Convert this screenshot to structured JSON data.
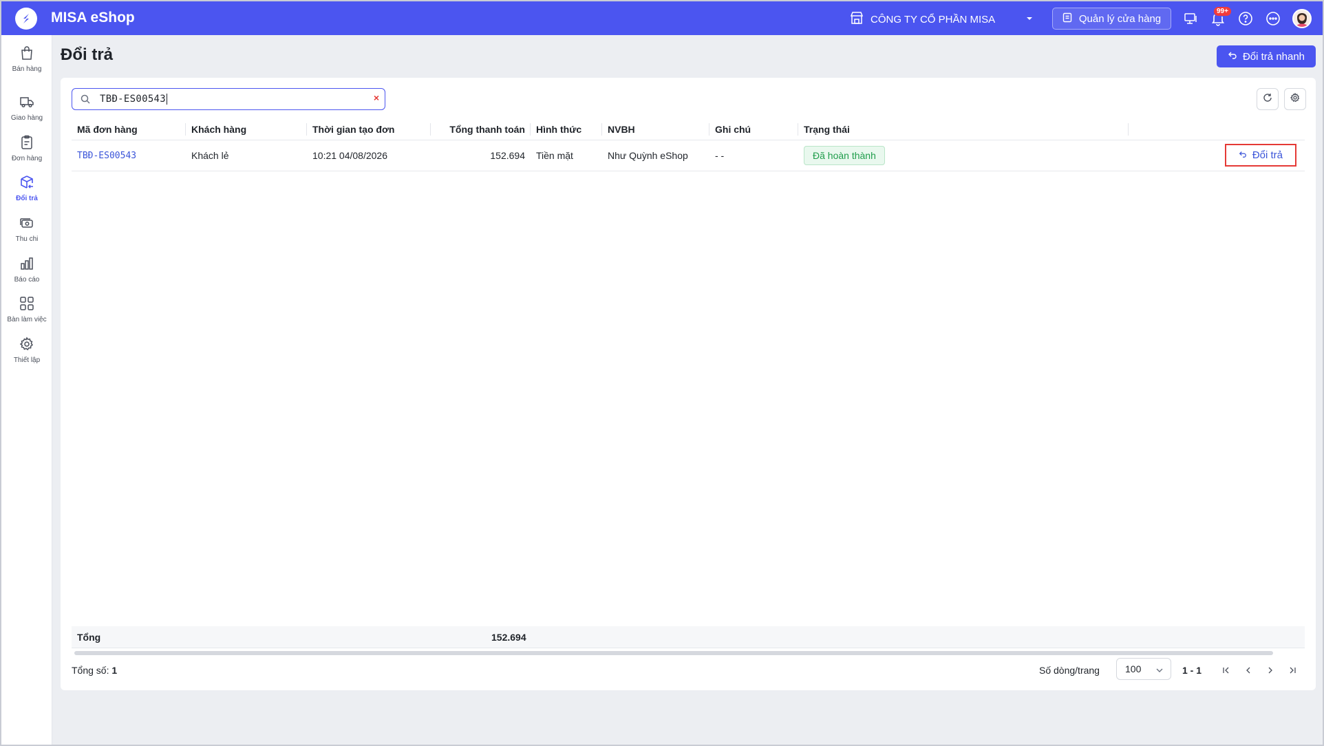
{
  "app": {
    "title": "MISA eShop"
  },
  "topbar": {
    "company": "CÔNG TY CỔ PHẦN MISA",
    "store_button": "Quản lý cửa hàng",
    "notification_badge": "99+"
  },
  "sidebar": {
    "items": [
      {
        "label": "Bán hàng",
        "icon": "shopping-bag-icon"
      },
      {
        "label": "Giao hàng",
        "icon": "delivery-truck-icon"
      },
      {
        "label": "Đơn hàng",
        "icon": "clipboard-icon"
      },
      {
        "label": "Đổi trả",
        "icon": "return-box-icon",
        "active": true
      },
      {
        "label": "Thu chi",
        "icon": "cash-icon"
      },
      {
        "label": "Báo cáo",
        "icon": "bar-chart-icon"
      },
      {
        "label": "Bàn làm việc",
        "icon": "grid-icon"
      },
      {
        "label": "Thiết lập",
        "icon": "gear-icon"
      }
    ]
  },
  "page": {
    "title": "Đổi trả",
    "quick_button": "Đổi trả nhanh"
  },
  "search": {
    "value": "TBĐ-ES00543",
    "clear": "×"
  },
  "table": {
    "columns": [
      "Mã đơn hàng",
      "Khách hàng",
      "Thời gian tạo đơn",
      "Tổng thanh toán",
      "Hình thức",
      "NVBH",
      "Ghi chú",
      "Trạng thái"
    ],
    "rows": [
      {
        "order_id": "TBĐ-ES00543",
        "customer": "Khách lẻ",
        "created": "10:21 04/08/2026",
        "total": "152.694",
        "method": "Tiền mặt",
        "staff": "Như Quỳnh eShop",
        "note": "- -",
        "status": "Đã hoàn thành",
        "action": "Đổi trả"
      }
    ],
    "total_label": "Tổng",
    "total_value": "152.694"
  },
  "footer": {
    "count_label": "Tổng số:",
    "count_value": "1",
    "rows_label": "Số dòng/trang",
    "rows_value": "100",
    "range": "1 - 1"
  },
  "colors": {
    "primary": "#4b55f0",
    "success": "#1f9d4b",
    "highlight": "#e53935"
  }
}
